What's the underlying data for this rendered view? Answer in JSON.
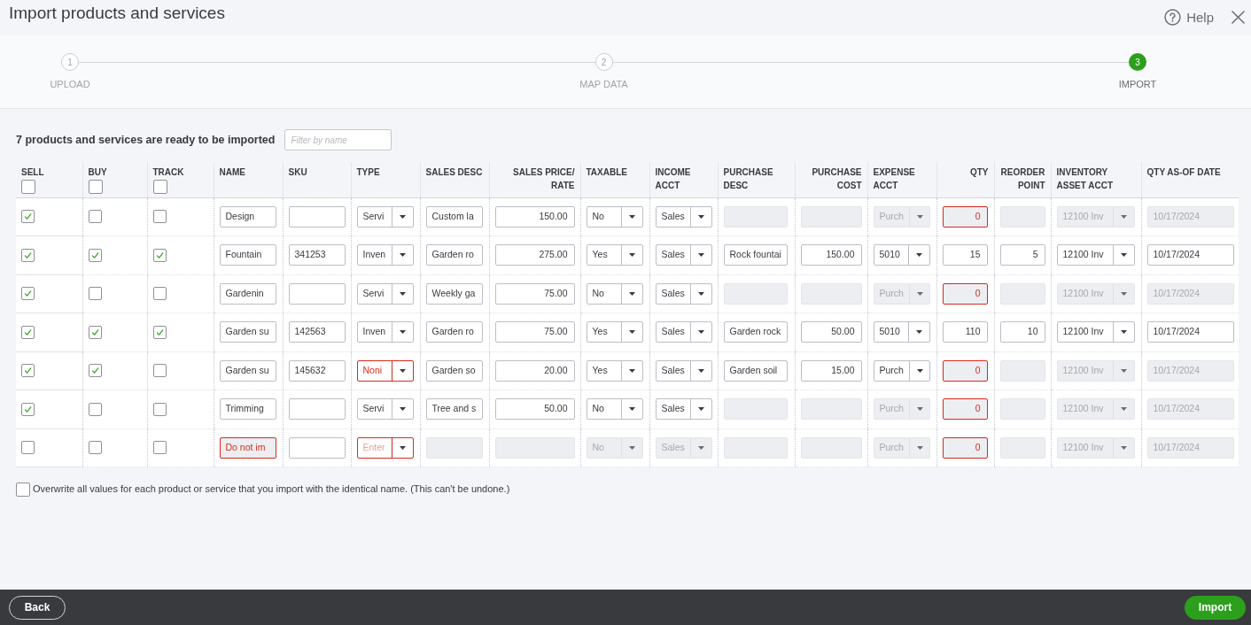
{
  "window": {
    "title": "Import products and services",
    "help_button": "Help"
  },
  "stepper": {
    "steps": [
      {
        "number": "1",
        "label": "UPLOAD",
        "selected": false
      },
      {
        "number": "2",
        "label": "MAP DATA",
        "selected": false
      },
      {
        "number": "3",
        "label": "IMPORT",
        "selected": true
      }
    ]
  },
  "summary": "7 products and services are ready to be imported",
  "filter": {
    "placeholder": "Filter by name"
  },
  "table": {
    "columns": [
      {
        "label": [
          "SELL"
        ],
        "kind": "checkbox",
        "checked": false
      },
      {
        "label": [
          "BUY"
        ],
        "kind": "checkbox",
        "checked": false
      },
      {
        "label": [
          "TRACK"
        ],
        "kind": "checkbox",
        "checked": false
      },
      {
        "label": [
          "NAME"
        ],
        "kind": "text"
      },
      {
        "label": [
          "SKU"
        ],
        "kind": "text"
      },
      {
        "label": [
          "TYPE"
        ],
        "kind": "select"
      },
      {
        "label": [
          "SALES DESC"
        ],
        "kind": "text"
      },
      {
        "label": [
          "SALES PRICE/",
          "RATE"
        ],
        "kind": "text"
      },
      {
        "label": [
          "TAXABLE"
        ],
        "kind": "select"
      },
      {
        "label": [
          "INCOME",
          "ACCT"
        ],
        "kind": "select"
      },
      {
        "label": [
          "PURCHASE",
          "DESC"
        ],
        "kind": "text"
      },
      {
        "label": [
          "PURCHASE",
          "COST"
        ],
        "kind": "text"
      },
      {
        "label": [
          "EXPENSE",
          "ACCT"
        ],
        "kind": "select"
      },
      {
        "label": [
          "QTY"
        ],
        "kind": "text"
      },
      {
        "label": [
          "REORDER",
          "POINT"
        ],
        "kind": "text"
      },
      {
        "label": [
          "INVENTORY",
          "ASSET ACCT"
        ],
        "kind": "select"
      },
      {
        "label": [
          "QTY AS-OF DATE"
        ],
        "kind": "text"
      }
    ],
    "rows": [
      {
        "cells": [
          {
            "checked": true
          },
          {
            "checked": false
          },
          {
            "checked": false
          },
          {
            "value": "Design",
            "disabled": false,
            "error": false
          },
          {
            "disabled": false,
            "error": false
          },
          {
            "value": "Servi",
            "disabled": false,
            "error": false
          },
          {
            "value": "Custom la",
            "disabled": false,
            "error": false
          },
          {
            "value": "150.00",
            "disabled": false,
            "error": false
          },
          {
            "value": "No",
            "disabled": false,
            "error": false
          },
          {
            "value": "Sales",
            "disabled": false,
            "error": false
          },
          {
            "disabled": true,
            "error": false
          },
          {
            "disabled": true,
            "error": false
          },
          {
            "value": "Purch",
            "disabled": true,
            "error": false
          },
          {
            "value": "0",
            "disabled": true,
            "error": true
          },
          {
            "disabled": true,
            "error": false
          },
          {
            "value": "12100 Inv",
            "disabled": true,
            "error": false
          },
          {
            "value": "10/17/2024",
            "disabled": true,
            "error": false
          }
        ]
      },
      {
        "cells": [
          {
            "checked": true
          },
          {
            "checked": true
          },
          {
            "checked": true
          },
          {
            "value": "Fountain",
            "disabled": false,
            "error": false
          },
          {
            "value": "341253",
            "disabled": false,
            "error": false
          },
          {
            "value": "Inven",
            "disabled": false,
            "error": false
          },
          {
            "value": "Garden ro",
            "disabled": false,
            "error": false
          },
          {
            "value": "275.00",
            "disabled": false,
            "error": false
          },
          {
            "value": "Yes",
            "disabled": false,
            "error": false
          },
          {
            "value": "Sales",
            "disabled": false,
            "error": false
          },
          {
            "value": "Rock fountai",
            "disabled": false,
            "error": false
          },
          {
            "value": "150.00",
            "disabled": false,
            "error": false
          },
          {
            "value": "5010",
            "disabled": false,
            "error": false
          },
          {
            "value": "15",
            "disabled": false,
            "error": false
          },
          {
            "value": "5",
            "disabled": false,
            "error": false
          },
          {
            "value": "12100 Inv",
            "disabled": false,
            "error": false
          },
          {
            "value": "10/17/2024",
            "disabled": false,
            "error": false
          }
        ]
      },
      {
        "cells": [
          {
            "checked": true
          },
          {
            "checked": false
          },
          {
            "checked": false
          },
          {
            "value": "Gardenin",
            "disabled": false,
            "error": false
          },
          {
            "disabled": false,
            "error": false
          },
          {
            "value": "Servi",
            "disabled": false,
            "error": false
          },
          {
            "value": "Weekly ga",
            "disabled": false,
            "error": false
          },
          {
            "value": "75.00",
            "disabled": false,
            "error": false
          },
          {
            "value": "No",
            "disabled": false,
            "error": false
          },
          {
            "value": "Sales",
            "disabled": false,
            "error": false
          },
          {
            "disabled": true,
            "error": false
          },
          {
            "disabled": true,
            "error": false
          },
          {
            "value": "Purch",
            "disabled": true,
            "error": false
          },
          {
            "value": "0",
            "disabled": true,
            "error": true
          },
          {
            "disabled": true,
            "error": false
          },
          {
            "value": "12100 Inv",
            "disabled": true,
            "error": false
          },
          {
            "value": "10/17/2024",
            "disabled": true,
            "error": false
          }
        ]
      },
      {
        "cells": [
          {
            "checked": true
          },
          {
            "checked": true
          },
          {
            "checked": true
          },
          {
            "value": "Garden su",
            "disabled": false,
            "error": false
          },
          {
            "value": "142563",
            "disabled": false,
            "error": false
          },
          {
            "value": "Inven",
            "disabled": false,
            "error": false
          },
          {
            "value": "Garden ro",
            "disabled": false,
            "error": false
          },
          {
            "value": "75.00",
            "disabled": false,
            "error": false
          },
          {
            "value": "Yes",
            "disabled": false,
            "error": false
          },
          {
            "value": "Sales",
            "disabled": false,
            "error": false
          },
          {
            "value": "Garden rock",
            "disabled": false,
            "error": false
          },
          {
            "value": "50.00",
            "disabled": false,
            "error": false
          },
          {
            "value": "5010",
            "disabled": false,
            "error": false
          },
          {
            "value": "110",
            "disabled": false,
            "error": false
          },
          {
            "value": "10",
            "disabled": false,
            "error": false
          },
          {
            "value": "12100 Inv",
            "disabled": false,
            "error": false
          },
          {
            "value": "10/17/2024",
            "disabled": false,
            "error": false
          }
        ]
      },
      {
        "cells": [
          {
            "checked": true
          },
          {
            "checked": true
          },
          {
            "checked": false
          },
          {
            "value": "Garden su",
            "disabled": false,
            "error": false
          },
          {
            "value": "145632",
            "disabled": false,
            "error": false
          },
          {
            "value": "Noni",
            "disabled": false,
            "error": true
          },
          {
            "value": "Garden so",
            "disabled": false,
            "error": false
          },
          {
            "value": "20.00",
            "disabled": false,
            "error": false
          },
          {
            "value": "Yes",
            "disabled": false,
            "error": false
          },
          {
            "value": "Sales",
            "disabled": false,
            "error": false
          },
          {
            "value": "Garden soil",
            "disabled": false,
            "error": false
          },
          {
            "value": "15.00",
            "disabled": false,
            "error": false
          },
          {
            "value": "Purch",
            "disabled": false,
            "error": false
          },
          {
            "value": "0",
            "disabled": true,
            "error": true
          },
          {
            "disabled": true,
            "error": false
          },
          {
            "value": "12100 Inv",
            "disabled": true,
            "error": false
          },
          {
            "value": "10/17/2024",
            "disabled": true,
            "error": false
          }
        ]
      },
      {
        "cells": [
          {
            "checked": true
          },
          {
            "checked": false
          },
          {
            "checked": false
          },
          {
            "value": "Trimming",
            "disabled": false,
            "error": false
          },
          {
            "disabled": false,
            "error": false
          },
          {
            "value": "Servi",
            "disabled": false,
            "error": false
          },
          {
            "value": "Tree and s",
            "disabled": false,
            "error": false
          },
          {
            "value": "50.00",
            "disabled": false,
            "error": false
          },
          {
            "value": "No",
            "disabled": false,
            "error": false
          },
          {
            "value": "Sales",
            "disabled": false,
            "error": false
          },
          {
            "disabled": true,
            "error": false
          },
          {
            "disabled": true,
            "error": false
          },
          {
            "value": "Purch",
            "disabled": true,
            "error": false
          },
          {
            "value": "0",
            "disabled": true,
            "error": true
          },
          {
            "disabled": true,
            "error": false
          },
          {
            "value": "12100 Inv",
            "disabled": true,
            "error": false
          },
          {
            "value": "10/17/2024",
            "disabled": true,
            "error": false
          }
        ]
      },
      {
        "cells": [
          {
            "checked": false
          },
          {
            "checked": false
          },
          {
            "checked": false
          },
          {
            "value": "Do not im",
            "disabled": true,
            "error": true
          },
          {
            "disabled": false,
            "error": false
          },
          {
            "placeholder": "Enter",
            "disabled": false,
            "error": true
          },
          {
            "disabled": true,
            "error": false
          },
          {
            "disabled": true,
            "error": false
          },
          {
            "value": "No",
            "disabled": true,
            "error": false
          },
          {
            "value": "Sales",
            "disabled": true,
            "error": false
          },
          {
            "disabled": true,
            "error": false
          },
          {
            "disabled": true,
            "error": false
          },
          {
            "value": "Purch",
            "disabled": true,
            "error": false
          },
          {
            "value": "0",
            "disabled": true,
            "error": true
          },
          {
            "disabled": true,
            "error": false
          },
          {
            "value": "12100 Inv",
            "disabled": true,
            "error": false
          },
          {
            "value": "10/17/2024",
            "disabled": true,
            "error": false
          }
        ]
      }
    ]
  },
  "overwrite": {
    "label": "Overwrite all values for each product or service that you import with the identical name. (This can't be undone.)",
    "checked": false
  },
  "footer": {
    "back_button": "Back",
    "import_button": "Import"
  }
}
